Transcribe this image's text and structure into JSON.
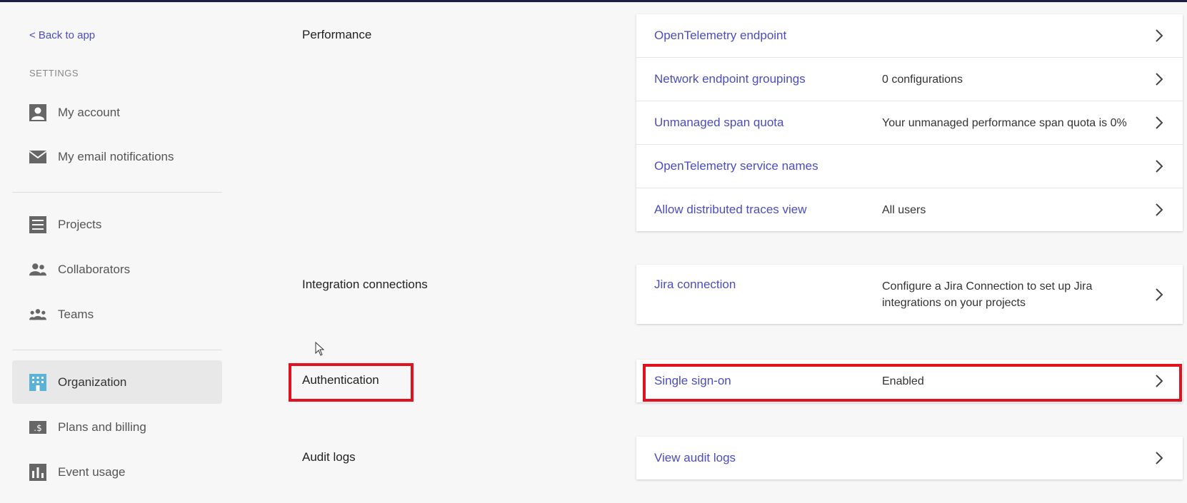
{
  "sidebar": {
    "back_label": "< Back to app",
    "settings_heading": "SETTINGS",
    "items": [
      {
        "label": "My account",
        "icon": "person-icon"
      },
      {
        "label": "My email notifications",
        "icon": "envelope-icon"
      },
      {
        "label": "Projects",
        "icon": "projects-icon"
      },
      {
        "label": "Collaborators",
        "icon": "collaborators-icon"
      },
      {
        "label": "Teams",
        "icon": "teams-icon"
      },
      {
        "label": "Organization",
        "icon": "building-icon",
        "active": true
      },
      {
        "label": "Plans and billing",
        "icon": "billing-icon"
      },
      {
        "label": "Event usage",
        "icon": "bar-chart-icon"
      }
    ]
  },
  "sections": {
    "performance": {
      "title": "Performance",
      "rows": [
        {
          "label": "OpenTelemetry endpoint",
          "value": ""
        },
        {
          "label": "Network endpoint groupings",
          "value": "0 configurations"
        },
        {
          "label": "Unmanaged span quota",
          "value": "Your unmanaged performance span quota is 0%"
        },
        {
          "label": "OpenTelemetry service names",
          "value": ""
        },
        {
          "label": "Allow distributed traces view",
          "value": "All users"
        }
      ]
    },
    "integrations": {
      "title": "Integration connections",
      "rows": [
        {
          "label": "Jira connection",
          "value": "Configure a Jira Connection to set up Jira integrations on your projects"
        }
      ]
    },
    "authentication": {
      "title": "Authentication",
      "rows": [
        {
          "label": "Single sign-on",
          "value": "Enabled"
        }
      ]
    },
    "audit": {
      "title": "Audit logs",
      "rows": [
        {
          "label": "View audit logs",
          "value": ""
        }
      ]
    }
  },
  "colors": {
    "link": "#4b4cc1",
    "highlight": "#e0121f",
    "active_nav_bg": "#e8e8e8",
    "top_bar": "#1b1f4a"
  }
}
